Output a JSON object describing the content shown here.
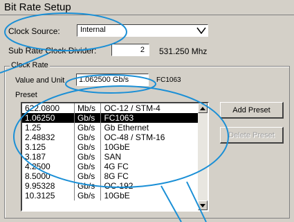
{
  "window": {
    "title": "Bit Rate Setup"
  },
  "clock_source": {
    "label": "Clock Source:",
    "value": "Internal"
  },
  "sub_rate": {
    "label": "Sub Rate Clock Divider:",
    "value": "2",
    "rate": "531.250 Mhz"
  },
  "clock_rate": {
    "group_label": "Clock Rate",
    "value_unit_label": "Value  and Unit",
    "value_unit": "1.062500 Gb/s",
    "code": "FC1063",
    "preset_label": "Preset"
  },
  "presets": [
    [
      "622.0800",
      "Mb/s",
      "OC-12 / STM-4"
    ],
    [
      "1.06250",
      "Gb/s",
      "FC1063"
    ],
    [
      "1.25",
      "Gb/s",
      "Gb Ethernet"
    ],
    [
      "2.48832",
      "Gb/s",
      "OC-48 / STM-16"
    ],
    [
      "3.125",
      "Gb/s",
      "10GbE"
    ],
    [
      "3.187",
      "Gb/s",
      "SAN"
    ],
    [
      "4.2500",
      "Gb/s",
      "4G FC"
    ],
    [
      "8.5000",
      "Gb/s",
      "8G FC"
    ],
    [
      "9.95328",
      "Gb/s",
      "OC-192"
    ],
    [
      "10.3125",
      "Gb/s",
      "10GbE"
    ]
  ],
  "selected_index": 1,
  "buttons": {
    "add": "Add Preset",
    "delete": "Delete Preset"
  },
  "colors": {
    "annotation": "#1a8fd6",
    "background": "#d4d0c8",
    "selection": "#000000"
  }
}
